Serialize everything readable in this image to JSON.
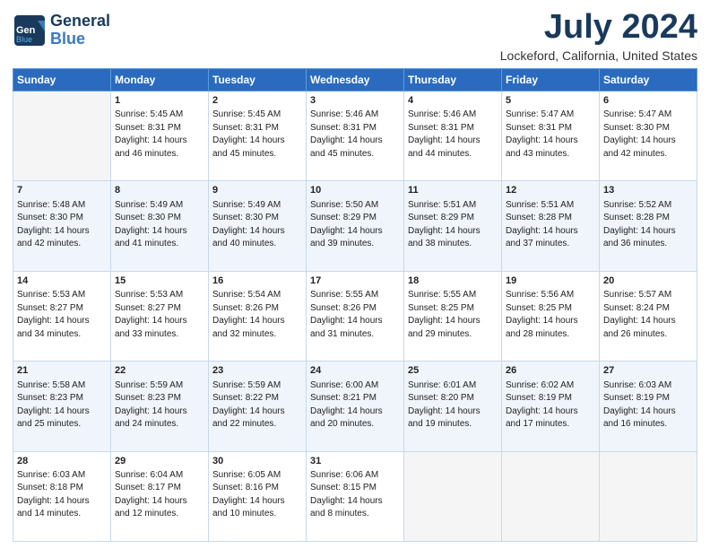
{
  "logo": {
    "line1": "General",
    "line2": "Blue"
  },
  "title": "July 2024",
  "subtitle": "Lockeford, California, United States",
  "days_of_week": [
    "Sunday",
    "Monday",
    "Tuesday",
    "Wednesday",
    "Thursday",
    "Friday",
    "Saturday"
  ],
  "weeks": [
    [
      {
        "day": "",
        "content": ""
      },
      {
        "day": "1",
        "content": "Sunrise: 5:45 AM\nSunset: 8:31 PM\nDaylight: 14 hours\nand 46 minutes."
      },
      {
        "day": "2",
        "content": "Sunrise: 5:45 AM\nSunset: 8:31 PM\nDaylight: 14 hours\nand 45 minutes."
      },
      {
        "day": "3",
        "content": "Sunrise: 5:46 AM\nSunset: 8:31 PM\nDaylight: 14 hours\nand 45 minutes."
      },
      {
        "day": "4",
        "content": "Sunrise: 5:46 AM\nSunset: 8:31 PM\nDaylight: 14 hours\nand 44 minutes."
      },
      {
        "day": "5",
        "content": "Sunrise: 5:47 AM\nSunset: 8:31 PM\nDaylight: 14 hours\nand 43 minutes."
      },
      {
        "day": "6",
        "content": "Sunrise: 5:47 AM\nSunset: 8:30 PM\nDaylight: 14 hours\nand 42 minutes."
      }
    ],
    [
      {
        "day": "7",
        "content": "Sunrise: 5:48 AM\nSunset: 8:30 PM\nDaylight: 14 hours\nand 42 minutes."
      },
      {
        "day": "8",
        "content": "Sunrise: 5:49 AM\nSunset: 8:30 PM\nDaylight: 14 hours\nand 41 minutes."
      },
      {
        "day": "9",
        "content": "Sunrise: 5:49 AM\nSunset: 8:30 PM\nDaylight: 14 hours\nand 40 minutes."
      },
      {
        "day": "10",
        "content": "Sunrise: 5:50 AM\nSunset: 8:29 PM\nDaylight: 14 hours\nand 39 minutes."
      },
      {
        "day": "11",
        "content": "Sunrise: 5:51 AM\nSunset: 8:29 PM\nDaylight: 14 hours\nand 38 minutes."
      },
      {
        "day": "12",
        "content": "Sunrise: 5:51 AM\nSunset: 8:28 PM\nDaylight: 14 hours\nand 37 minutes."
      },
      {
        "day": "13",
        "content": "Sunrise: 5:52 AM\nSunset: 8:28 PM\nDaylight: 14 hours\nand 36 minutes."
      }
    ],
    [
      {
        "day": "14",
        "content": "Sunrise: 5:53 AM\nSunset: 8:27 PM\nDaylight: 14 hours\nand 34 minutes."
      },
      {
        "day": "15",
        "content": "Sunrise: 5:53 AM\nSunset: 8:27 PM\nDaylight: 14 hours\nand 33 minutes."
      },
      {
        "day": "16",
        "content": "Sunrise: 5:54 AM\nSunset: 8:26 PM\nDaylight: 14 hours\nand 32 minutes."
      },
      {
        "day": "17",
        "content": "Sunrise: 5:55 AM\nSunset: 8:26 PM\nDaylight: 14 hours\nand 31 minutes."
      },
      {
        "day": "18",
        "content": "Sunrise: 5:55 AM\nSunset: 8:25 PM\nDaylight: 14 hours\nand 29 minutes."
      },
      {
        "day": "19",
        "content": "Sunrise: 5:56 AM\nSunset: 8:25 PM\nDaylight: 14 hours\nand 28 minutes."
      },
      {
        "day": "20",
        "content": "Sunrise: 5:57 AM\nSunset: 8:24 PM\nDaylight: 14 hours\nand 26 minutes."
      }
    ],
    [
      {
        "day": "21",
        "content": "Sunrise: 5:58 AM\nSunset: 8:23 PM\nDaylight: 14 hours\nand 25 minutes."
      },
      {
        "day": "22",
        "content": "Sunrise: 5:59 AM\nSunset: 8:23 PM\nDaylight: 14 hours\nand 24 minutes."
      },
      {
        "day": "23",
        "content": "Sunrise: 5:59 AM\nSunset: 8:22 PM\nDaylight: 14 hours\nand 22 minutes."
      },
      {
        "day": "24",
        "content": "Sunrise: 6:00 AM\nSunset: 8:21 PM\nDaylight: 14 hours\nand 20 minutes."
      },
      {
        "day": "25",
        "content": "Sunrise: 6:01 AM\nSunset: 8:20 PM\nDaylight: 14 hours\nand 19 minutes."
      },
      {
        "day": "26",
        "content": "Sunrise: 6:02 AM\nSunset: 8:19 PM\nDaylight: 14 hours\nand 17 minutes."
      },
      {
        "day": "27",
        "content": "Sunrise: 6:03 AM\nSunset: 8:19 PM\nDaylight: 14 hours\nand 16 minutes."
      }
    ],
    [
      {
        "day": "28",
        "content": "Sunrise: 6:03 AM\nSunset: 8:18 PM\nDaylight: 14 hours\nand 14 minutes."
      },
      {
        "day": "29",
        "content": "Sunrise: 6:04 AM\nSunset: 8:17 PM\nDaylight: 14 hours\nand 12 minutes."
      },
      {
        "day": "30",
        "content": "Sunrise: 6:05 AM\nSunset: 8:16 PM\nDaylight: 14 hours\nand 10 minutes."
      },
      {
        "day": "31",
        "content": "Sunrise: 6:06 AM\nSunset: 8:15 PM\nDaylight: 14 hours\nand 8 minutes."
      },
      {
        "day": "",
        "content": ""
      },
      {
        "day": "",
        "content": ""
      },
      {
        "day": "",
        "content": ""
      }
    ]
  ]
}
